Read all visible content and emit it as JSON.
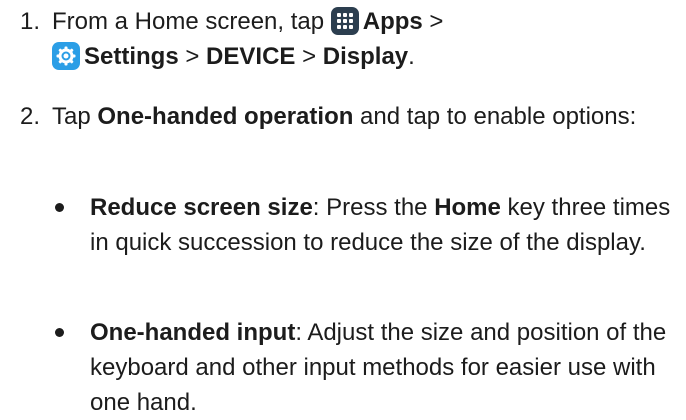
{
  "steps": [
    {
      "number": "1.",
      "text_a": "From a Home screen, tap ",
      "apps_label": "Apps",
      "sep1": " >",
      "settings_label": "Settings",
      "sep2": " > ",
      "device_label": "DEVICE",
      "sep3": " > ",
      "display_label": "Display",
      "end": ".",
      "apps_icon": "apps-grid-icon",
      "settings_icon": "settings-gear-icon",
      "apps_icon_color": "#2c3e4f",
      "settings_icon_color": "#2b9ee6"
    },
    {
      "number": "2.",
      "text_a": "Tap ",
      "option_label": "One-handed operation",
      "text_b": " and tap to enable options:"
    }
  ],
  "bullets": [
    {
      "title": "Reduce screen size",
      "text_a": ": Press the ",
      "key_label": "Home",
      "text_b": " key three times in quick succession to reduce the size of the display."
    },
    {
      "title": "One-handed input",
      "text_a": ": Adjust the size and position of the keyboard and other input methods for easier use with one hand."
    }
  ]
}
